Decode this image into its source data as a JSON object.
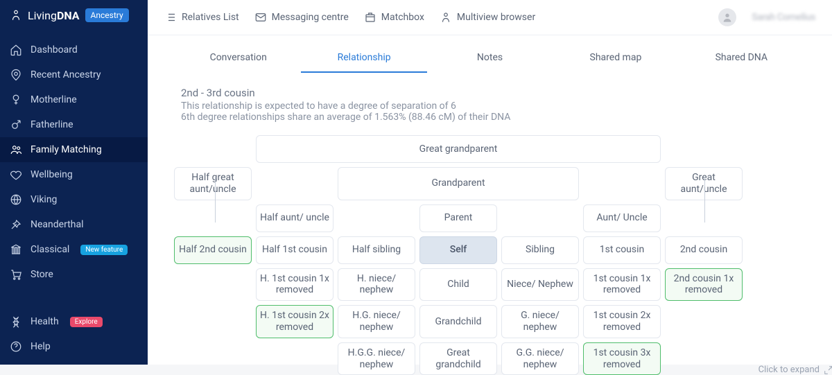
{
  "brand": {
    "name_light": "Living",
    "name_bold": "DNA",
    "badge": "Ancestry"
  },
  "user": {
    "name": "Sarah Cornelius"
  },
  "sidebar": {
    "items": [
      {
        "label": "Dashboard",
        "icon": "home"
      },
      {
        "label": "Recent Ancestry",
        "icon": "pin"
      },
      {
        "label": "Motherline",
        "icon": "female"
      },
      {
        "label": "Fatherline",
        "icon": "male"
      },
      {
        "label": "Family Matching",
        "icon": "people",
        "active": true
      },
      {
        "label": "Wellbeing",
        "icon": "heart"
      },
      {
        "label": "Viking",
        "icon": "globe"
      },
      {
        "label": "Neanderthal",
        "icon": "spear"
      },
      {
        "label": "Classical",
        "icon": "column",
        "pill": "New feature",
        "pillClass": ""
      },
      {
        "label": "Store",
        "icon": "cart"
      }
    ],
    "bottom": [
      {
        "label": "Health",
        "icon": "dna",
        "pill": "Explore",
        "pillClass": "red"
      },
      {
        "label": "Help",
        "icon": "help"
      }
    ]
  },
  "topbar": {
    "links": [
      {
        "label": "Relatives List",
        "icon": "list"
      },
      {
        "label": "Messaging centre",
        "icon": "mail"
      },
      {
        "label": "Matchbox",
        "icon": "box"
      },
      {
        "label": "Multiview browser",
        "icon": "person"
      }
    ]
  },
  "tabs": [
    {
      "label": "Conversation"
    },
    {
      "label": "Relationship",
      "active": true
    },
    {
      "label": "Notes"
    },
    {
      "label": "Shared map"
    },
    {
      "label": "Shared DNA"
    }
  ],
  "relationship": {
    "title": "2nd - 3rd cousin",
    "line1": "This relationship is expected to have a degree of separation of 6",
    "line2": "6th degree relationships share an average of 1.563% (88.46 cM) of their DNA"
  },
  "chart": {
    "rows": [
      [
        null,
        {
          "text": "Great grandparent",
          "span": "wide"
        },
        null
      ],
      [
        {
          "text": "Half great aunt/uncle"
        },
        null,
        {
          "text": "Grandparent",
          "span": "mid3"
        },
        null,
        {
          "text": "Great aunt/uncle"
        }
      ],
      [
        null,
        {
          "text": "Half aunt/ uncle"
        },
        null,
        {
          "text": "Parent"
        },
        null,
        {
          "text": "Aunt/ Uncle"
        },
        null
      ],
      [
        {
          "text": "Half 2nd cousin",
          "hl": true
        },
        {
          "text": "Half 1st cousin"
        },
        {
          "text": "Half sibling"
        },
        {
          "text": "Self",
          "self": true
        },
        {
          "text": "Sibling"
        },
        {
          "text": "1st cousin"
        },
        {
          "text": "2nd cousin"
        }
      ],
      [
        null,
        {
          "text": "H. 1st cousin 1x removed"
        },
        {
          "text": "H. niece/ nephew"
        },
        {
          "text": "Child"
        },
        {
          "text": "Niece/ Nephew"
        },
        {
          "text": "1st cousin 1x removed"
        },
        {
          "text": "2nd cousin 1x removed",
          "hl": true
        }
      ],
      [
        null,
        {
          "text": "H. 1st cousin 2x removed",
          "hl": true
        },
        {
          "text": "H.G. niece/ nephew"
        },
        {
          "text": "Grandchild"
        },
        {
          "text": "G. niece/ nephew"
        },
        {
          "text": "1st cousin 2x removed"
        },
        null
      ],
      [
        null,
        null,
        {
          "text": "H.G.G. niece/ nephew"
        },
        {
          "text": "Great grandchild"
        },
        {
          "text": "G.G. niece/ nephew"
        },
        {
          "text": "1st cousin 3x removed",
          "hl": true
        },
        null
      ]
    ],
    "expand_hint": "Click to expand"
  }
}
